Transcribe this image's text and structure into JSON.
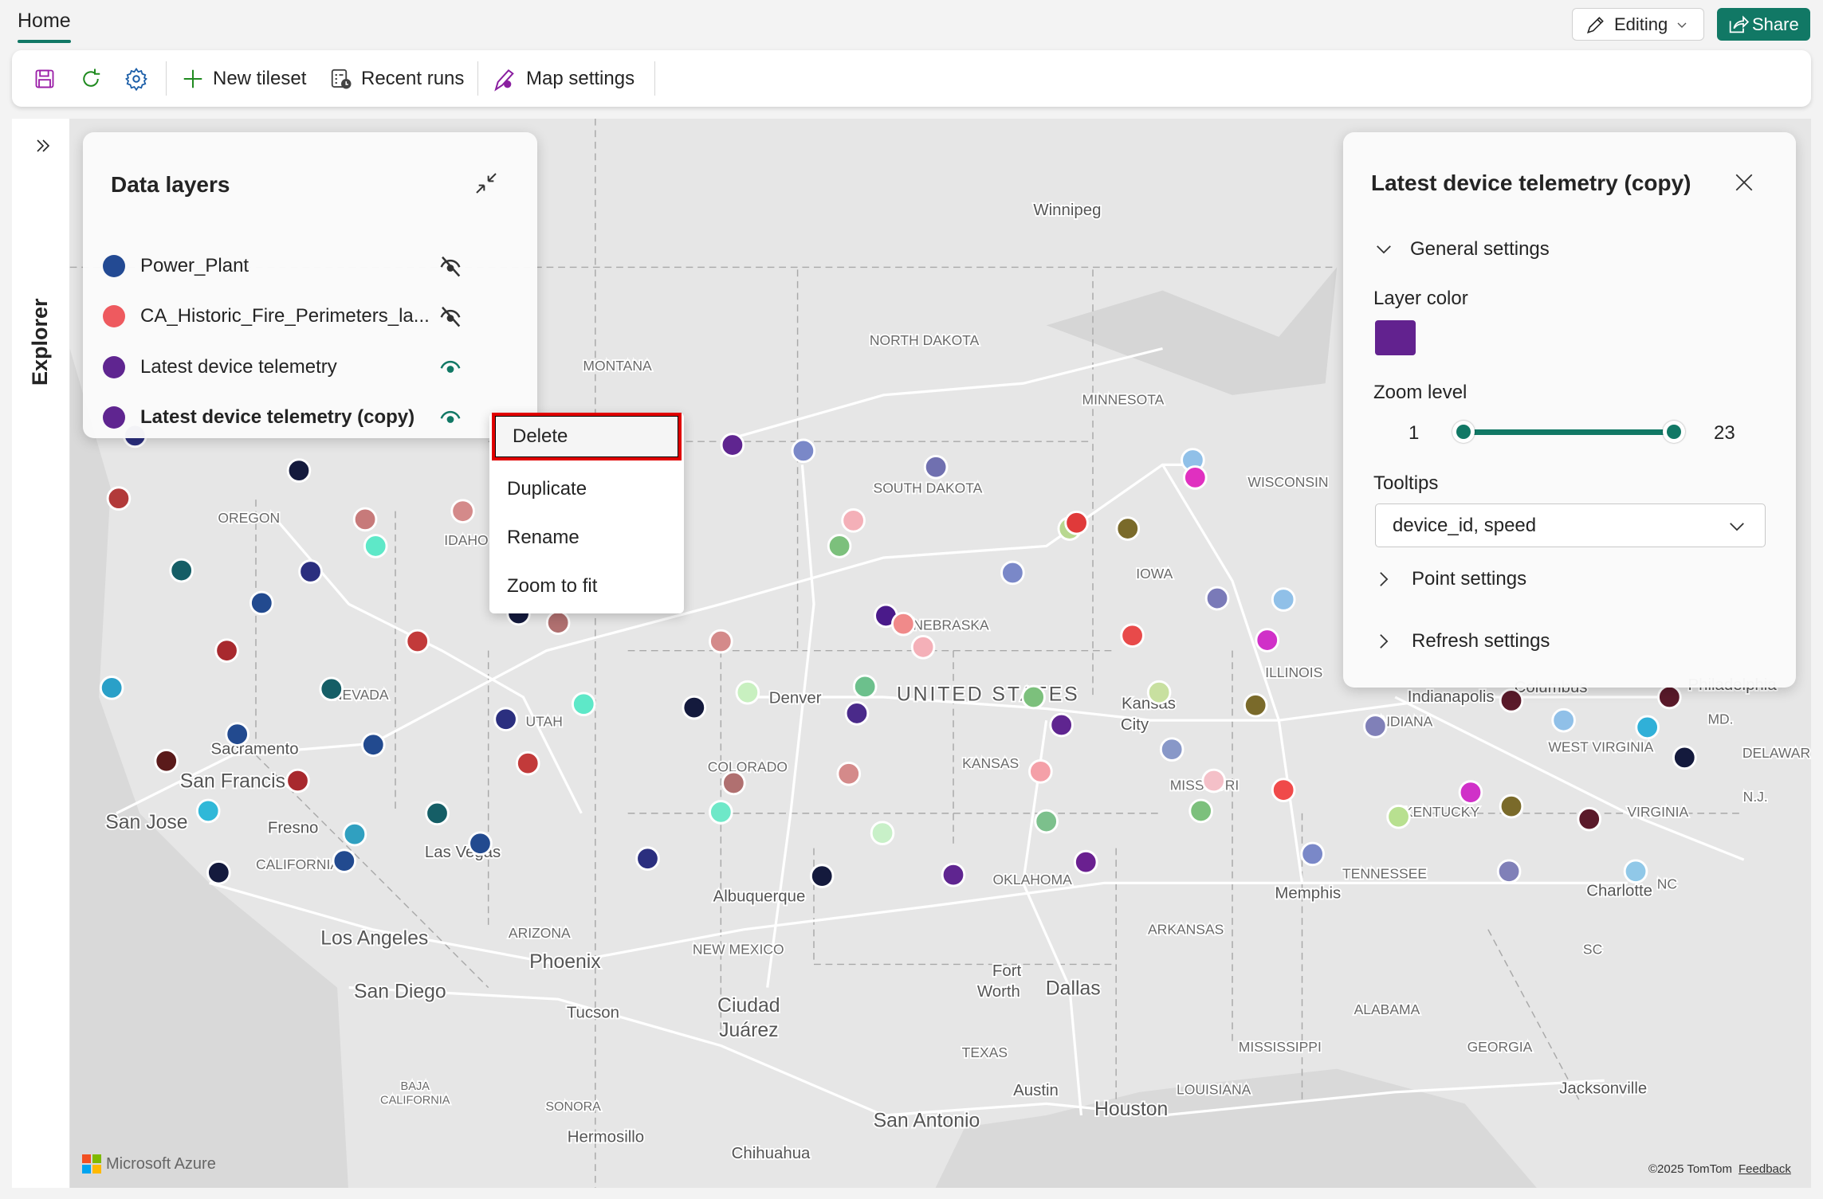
{
  "header": {
    "tab_home": "Home",
    "editing_label": "Editing",
    "share_label": "Share"
  },
  "toolbar": {
    "save_icon": "save-icon",
    "refresh_icon": "refresh-icon",
    "settings_icon": "gear-icon",
    "new_tileset": "New tileset",
    "recent_runs": "Recent runs",
    "map_settings": "Map settings"
  },
  "explorer": {
    "label": "Explorer"
  },
  "data_layers": {
    "title": "Data layers",
    "layers": [
      {
        "name": "Power_Plant",
        "color": "#234a93",
        "visible": false,
        "selected": false
      },
      {
        "name": "CA_Historic_Fire_Perimeters_la...",
        "color": "#ee5a5f",
        "visible": false,
        "selected": false
      },
      {
        "name": "Latest device telemetry",
        "color": "#5f2590",
        "visible": true,
        "selected": false
      },
      {
        "name": "Latest device telemetry (copy)",
        "color": "#5f2590",
        "visible": true,
        "selected": true
      }
    ]
  },
  "context_menu": {
    "items": [
      "Delete",
      "Duplicate",
      "Rename",
      "Zoom to fit"
    ],
    "focused": "Delete"
  },
  "layer_properties": {
    "title": "Latest device telemetry (copy)",
    "general_settings": "General settings",
    "layer_color_label": "Layer color",
    "layer_color": "#62228f",
    "zoom_level_label": "Zoom level",
    "zoom_min": "1",
    "zoom_max": "23",
    "tooltips_label": "Tooltips",
    "tooltips_value": "device_id, speed",
    "point_settings": "Point settings",
    "refresh_settings": "Refresh settings"
  },
  "map": {
    "labels": [
      "Winnipeg",
      "MONTANA",
      "NORTH DAKOTA",
      "MINNESOTA",
      "SOUTH DAKOTA",
      "WISCONSIN",
      "OREGON",
      "IDAHO",
      "IOWA",
      "NEBRASKA",
      "ILLINOIS",
      "NEVADA",
      "Denver",
      "UNITED STATES",
      "Kansas",
      "City",
      "Indianapolis",
      "INDIANA",
      "UTAH",
      "Sacramento",
      "COLORADO",
      "KANSAS",
      "MISSOURI",
      "WEST VIRGINIA",
      "San Francisco",
      "KENTUCKY",
      "VIRGINIA",
      "San Jose",
      "Fresno",
      "CALIFORNIA",
      "Las Vegas",
      "TENNESSEE",
      "OKLAHOMA",
      "Charlotte",
      "Albuquerque",
      "Memphis",
      "Los Angeles",
      "ARIZONA",
      "ARKANSAS",
      "NEW MEXICO",
      "Phoenix",
      "SC",
      "Fort",
      "Worth",
      "Dallas",
      "San Diego",
      "Ciudad",
      "Juárez",
      "Tucson",
      "ALABAMA",
      "MISSISSIPPI",
      "GEORGIA",
      "TEXAS",
      "BAJA",
      "CALIFORNIA",
      "Austin",
      "LOUISIANA",
      "Jacksonville",
      "Houston",
      "SONORA",
      "San Antonio",
      "Hermosillo",
      "Chihuahua",
      "Columbus",
      "Philadelphia",
      "MD.",
      "DELAWAR",
      "NC",
      "N.J."
    ],
    "brand": "Microsoft Azure",
    "copyright": "©2025 TomTom",
    "feedback": "Feedback"
  }
}
